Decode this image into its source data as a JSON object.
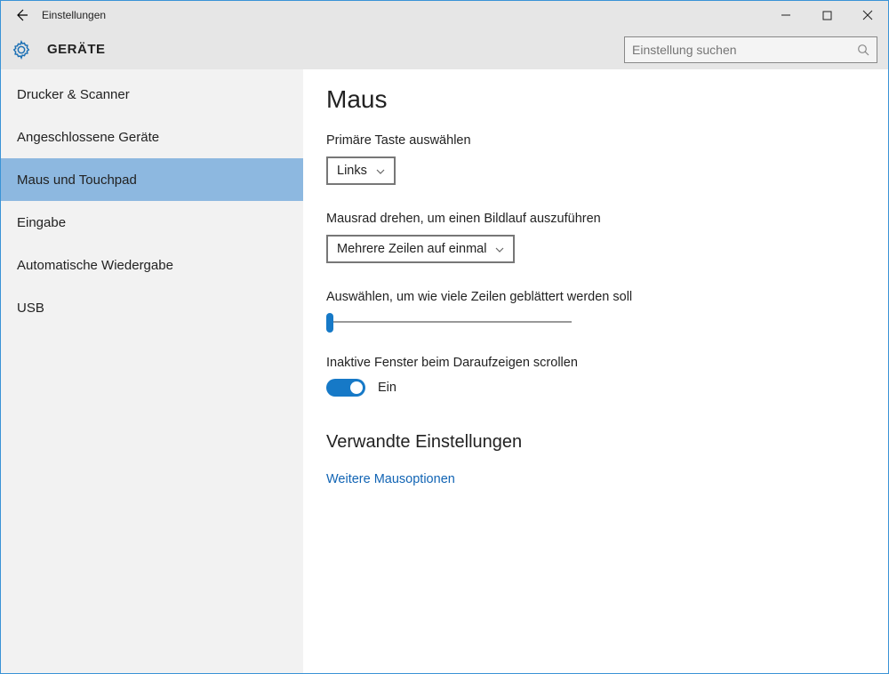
{
  "window": {
    "title": "Einstellungen"
  },
  "header": {
    "category": "GERÄTE",
    "search_placeholder": "Einstellung suchen"
  },
  "sidebar": {
    "items": [
      {
        "label": "Drucker & Scanner"
      },
      {
        "label": "Angeschlossene Geräte"
      },
      {
        "label": "Maus und Touchpad"
      },
      {
        "label": "Eingabe"
      },
      {
        "label": "Automatische Wiedergabe"
      },
      {
        "label": "USB"
      }
    ],
    "active_index": 2
  },
  "content": {
    "heading": "Maus",
    "primary_button": {
      "label": "Primäre Taste auswählen",
      "value": "Links"
    },
    "wheel_mode": {
      "label": "Mausrad drehen, um einen Bildlauf auszuführen",
      "value": "Mehrere Zeilen auf einmal"
    },
    "lines": {
      "label": "Auswählen, um wie viele Zeilen geblättert werden soll"
    },
    "inactive_scroll": {
      "label": "Inaktive Fenster beim Daraufzeigen scrollen",
      "state": "Ein"
    },
    "related": {
      "heading": "Verwandte Einstellungen",
      "link": "Weitere Mausoptionen"
    }
  },
  "colors": {
    "accent": "#1679c7",
    "sidebar_active": "#8db8e0"
  }
}
